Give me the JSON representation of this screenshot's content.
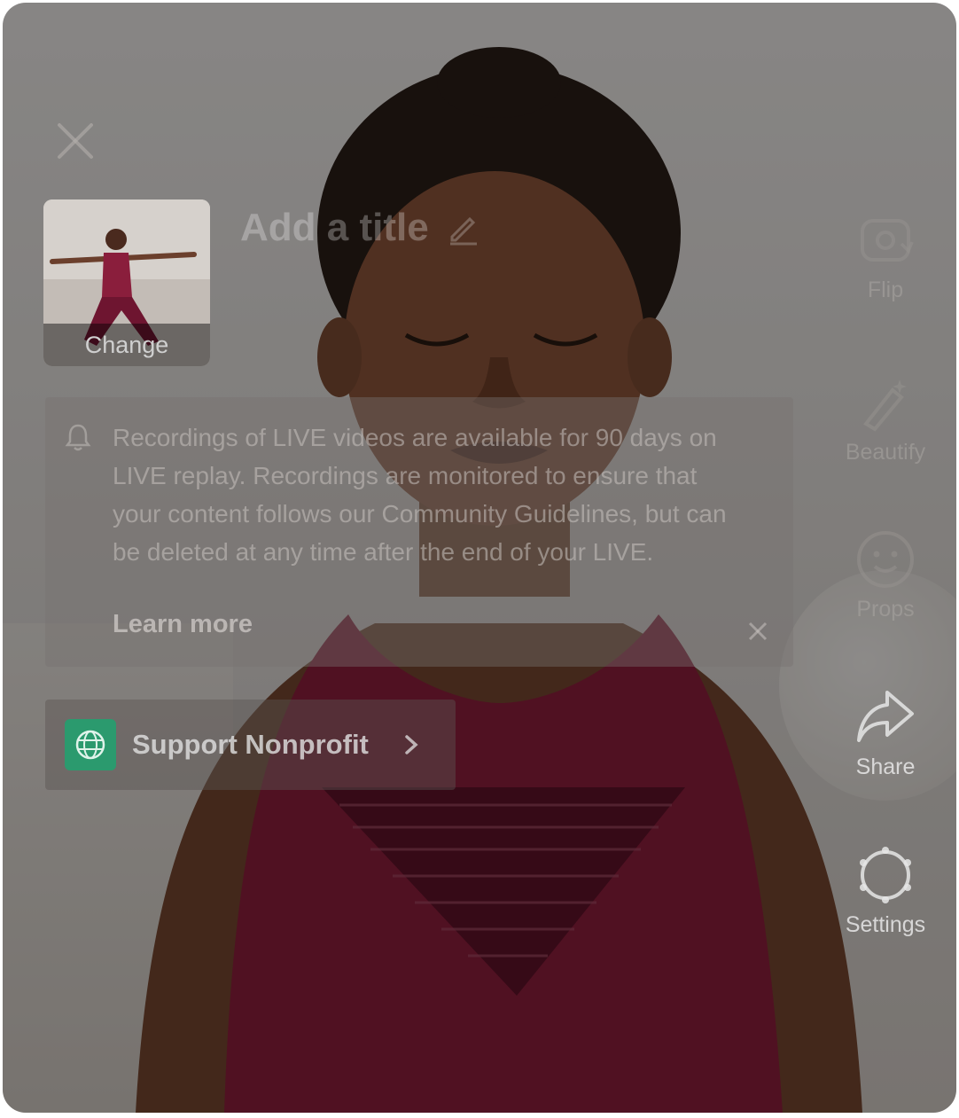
{
  "overlay": {
    "close_icon": "close-icon",
    "cover": {
      "change_label": "Change"
    },
    "title": {
      "placeholder": "Add a title",
      "edit_icon": "pencil-icon"
    }
  },
  "notice": {
    "icon": "bell-icon",
    "text": "Recordings of LIVE videos are available for 90 days on LIVE replay. Recordings are monitored to ensure that your content follows our Community Guidelines, but can be deleted at any time after the end of your LIVE.",
    "learn_more": "Learn more",
    "close_icon": "close-icon"
  },
  "support": {
    "label": "Support Nonprofit",
    "icon": "globe-icon",
    "accent": "#2b9a6e"
  },
  "rail": {
    "flip": "Flip",
    "beautify": "Beautify",
    "props": "Props",
    "share": "Share",
    "settings": "Settings"
  }
}
